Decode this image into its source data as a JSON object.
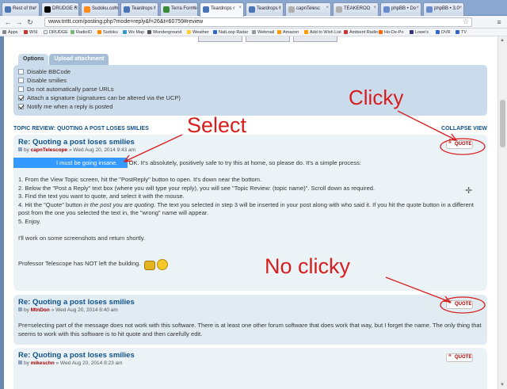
{
  "browser": {
    "tabs": [
      {
        "label": "Rest of the"
      },
      {
        "label": "DRUDGE R"
      },
      {
        "label": "Sudoku.com"
      },
      {
        "label": "Teardrops r"
      },
      {
        "label": "Terra Forme"
      },
      {
        "label": "Teardrops r",
        "active": true
      },
      {
        "label": "Teardrops r"
      },
      {
        "label": "capnTelesc"
      },
      {
        "label": "TEAKEROO"
      },
      {
        "label": "phpBB • Do"
      },
      {
        "label": "phpBB • 3.0"
      }
    ],
    "url": "www.tnttt.com/posting.php?mode=reply&f=26&t=60759#review",
    "bookmarks": [
      "Apps",
      "WSI",
      "DRUDGE",
      "RadioID",
      "Sudoku",
      "Wx Map",
      "Wunderground",
      "Weather",
      "NatLoop Radar",
      "Webmail",
      "Amazon",
      "Add to Wish List",
      "Ambient Radio",
      "Ho-De-Po",
      "Lowe's",
      "DVR",
      "TV"
    ]
  },
  "options": {
    "tabs": [
      "Options",
      "Upload attachment"
    ],
    "checkboxes": [
      {
        "label": "Disable BBCode",
        "checked": false
      },
      {
        "label": "Disable smilies",
        "checked": false
      },
      {
        "label": "Do not automatically parse URLs",
        "checked": false
      },
      {
        "label": "Attach a signature (signatures can be altered via the UCP)",
        "checked": true
      },
      {
        "label": "Notify me when a reply is posted",
        "checked": true
      }
    ]
  },
  "review": {
    "title": "TOPIC REVIEW: QUOTING A POST LOSES SMILIES",
    "collapse": "COLLAPSE VIEW"
  },
  "posts": [
    {
      "title": "Re: Quoting a post loses smilies",
      "by": "by",
      "author": "capnTelescope",
      "date": "» Wed Aug 20, 2014 9:43 am",
      "quote": "QUOTE",
      "selected": "I must be going insane.",
      "intro": " OK. It's absolutely, positively safe to try this at home, so please do. It's a simple process:",
      "steps": [
        "1. From the View Topic screen, hit the \"PostReply\" button to open. It's down near the bottom.",
        "2. Below the \"Post a Reply\" text box (where you will type your reply), you will see \"Topic Review: (topic name)\". Scroll down as required.",
        "3. Find the text you want to quote, and select it with the mouse."
      ],
      "step4a": "4. Hit the \"Quote\" button ",
      "step4em": "in the post you are quoting",
      "step4b": ". The text you selected in step 3 will be inserted in your post along with who said it. If you hit the quote button in a different post from the one you selected the text in, the \"wrong\" name will appear.",
      "step5": "5. Enjoy.",
      "outro": "I'll work on some screenshots and return shortly.",
      "signature": "Professor Telescope has NOT left the building."
    },
    {
      "title": "Re: Quoting a post loses smilies",
      "by": "by",
      "author": "MtnDon",
      "date": "» Wed Aug 20, 2014 8:40 am",
      "quote": "QUOTE",
      "body": "Pre=selecting part of the message does not work with this software. There is at least one other forum software that does work that way, but I forget the name. The only thing that seems to work with this software is to hit quote and then carefully edit."
    },
    {
      "title": "Re: Quoting a post loses smilies",
      "by": "by",
      "author": "mikeschn",
      "date": "» Wed Aug 20, 2014 8:23 am",
      "quote": "QUOTE"
    }
  ],
  "annotations": {
    "clicky": "Clicky",
    "select": "Select",
    "no_clicky": "No clicky",
    "color": "#d81d1d"
  }
}
